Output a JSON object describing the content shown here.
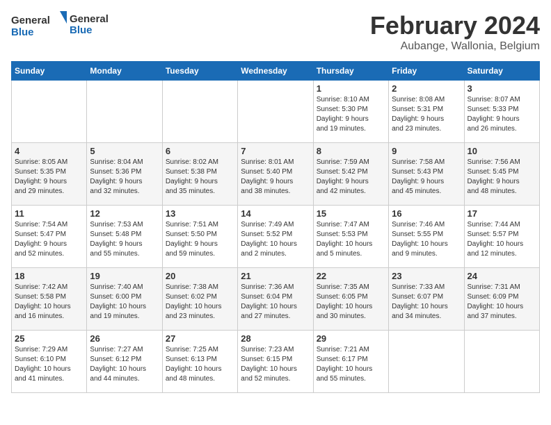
{
  "logo": {
    "line1": "General",
    "line2": "Blue"
  },
  "title": "February 2024",
  "subtitle": "Aubange, Wallonia, Belgium",
  "days_header": [
    "Sunday",
    "Monday",
    "Tuesday",
    "Wednesday",
    "Thursday",
    "Friday",
    "Saturday"
  ],
  "weeks": [
    [
      {
        "day": "",
        "info": ""
      },
      {
        "day": "",
        "info": ""
      },
      {
        "day": "",
        "info": ""
      },
      {
        "day": "",
        "info": ""
      },
      {
        "day": "1",
        "info": "Sunrise: 8:10 AM\nSunset: 5:30 PM\nDaylight: 9 hours\nand 19 minutes."
      },
      {
        "day": "2",
        "info": "Sunrise: 8:08 AM\nSunset: 5:31 PM\nDaylight: 9 hours\nand 23 minutes."
      },
      {
        "day": "3",
        "info": "Sunrise: 8:07 AM\nSunset: 5:33 PM\nDaylight: 9 hours\nand 26 minutes."
      }
    ],
    [
      {
        "day": "4",
        "info": "Sunrise: 8:05 AM\nSunset: 5:35 PM\nDaylight: 9 hours\nand 29 minutes."
      },
      {
        "day": "5",
        "info": "Sunrise: 8:04 AM\nSunset: 5:36 PM\nDaylight: 9 hours\nand 32 minutes."
      },
      {
        "day": "6",
        "info": "Sunrise: 8:02 AM\nSunset: 5:38 PM\nDaylight: 9 hours\nand 35 minutes."
      },
      {
        "day": "7",
        "info": "Sunrise: 8:01 AM\nSunset: 5:40 PM\nDaylight: 9 hours\nand 38 minutes."
      },
      {
        "day": "8",
        "info": "Sunrise: 7:59 AM\nSunset: 5:42 PM\nDaylight: 9 hours\nand 42 minutes."
      },
      {
        "day": "9",
        "info": "Sunrise: 7:58 AM\nSunset: 5:43 PM\nDaylight: 9 hours\nand 45 minutes."
      },
      {
        "day": "10",
        "info": "Sunrise: 7:56 AM\nSunset: 5:45 PM\nDaylight: 9 hours\nand 48 minutes."
      }
    ],
    [
      {
        "day": "11",
        "info": "Sunrise: 7:54 AM\nSunset: 5:47 PM\nDaylight: 9 hours\nand 52 minutes."
      },
      {
        "day": "12",
        "info": "Sunrise: 7:53 AM\nSunset: 5:48 PM\nDaylight: 9 hours\nand 55 minutes."
      },
      {
        "day": "13",
        "info": "Sunrise: 7:51 AM\nSunset: 5:50 PM\nDaylight: 9 hours\nand 59 minutes."
      },
      {
        "day": "14",
        "info": "Sunrise: 7:49 AM\nSunset: 5:52 PM\nDaylight: 10 hours\nand 2 minutes."
      },
      {
        "day": "15",
        "info": "Sunrise: 7:47 AM\nSunset: 5:53 PM\nDaylight: 10 hours\nand 5 minutes."
      },
      {
        "day": "16",
        "info": "Sunrise: 7:46 AM\nSunset: 5:55 PM\nDaylight: 10 hours\nand 9 minutes."
      },
      {
        "day": "17",
        "info": "Sunrise: 7:44 AM\nSunset: 5:57 PM\nDaylight: 10 hours\nand 12 minutes."
      }
    ],
    [
      {
        "day": "18",
        "info": "Sunrise: 7:42 AM\nSunset: 5:58 PM\nDaylight: 10 hours\nand 16 minutes."
      },
      {
        "day": "19",
        "info": "Sunrise: 7:40 AM\nSunset: 6:00 PM\nDaylight: 10 hours\nand 19 minutes."
      },
      {
        "day": "20",
        "info": "Sunrise: 7:38 AM\nSunset: 6:02 PM\nDaylight: 10 hours\nand 23 minutes."
      },
      {
        "day": "21",
        "info": "Sunrise: 7:36 AM\nSunset: 6:04 PM\nDaylight: 10 hours\nand 27 minutes."
      },
      {
        "day": "22",
        "info": "Sunrise: 7:35 AM\nSunset: 6:05 PM\nDaylight: 10 hours\nand 30 minutes."
      },
      {
        "day": "23",
        "info": "Sunrise: 7:33 AM\nSunset: 6:07 PM\nDaylight: 10 hours\nand 34 minutes."
      },
      {
        "day": "24",
        "info": "Sunrise: 7:31 AM\nSunset: 6:09 PM\nDaylight: 10 hours\nand 37 minutes."
      }
    ],
    [
      {
        "day": "25",
        "info": "Sunrise: 7:29 AM\nSunset: 6:10 PM\nDaylight: 10 hours\nand 41 minutes."
      },
      {
        "day": "26",
        "info": "Sunrise: 7:27 AM\nSunset: 6:12 PM\nDaylight: 10 hours\nand 44 minutes."
      },
      {
        "day": "27",
        "info": "Sunrise: 7:25 AM\nSunset: 6:13 PM\nDaylight: 10 hours\nand 48 minutes."
      },
      {
        "day": "28",
        "info": "Sunrise: 7:23 AM\nSunset: 6:15 PM\nDaylight: 10 hours\nand 52 minutes."
      },
      {
        "day": "29",
        "info": "Sunrise: 7:21 AM\nSunset: 6:17 PM\nDaylight: 10 hours\nand 55 minutes."
      },
      {
        "day": "",
        "info": ""
      },
      {
        "day": "",
        "info": ""
      }
    ]
  ]
}
